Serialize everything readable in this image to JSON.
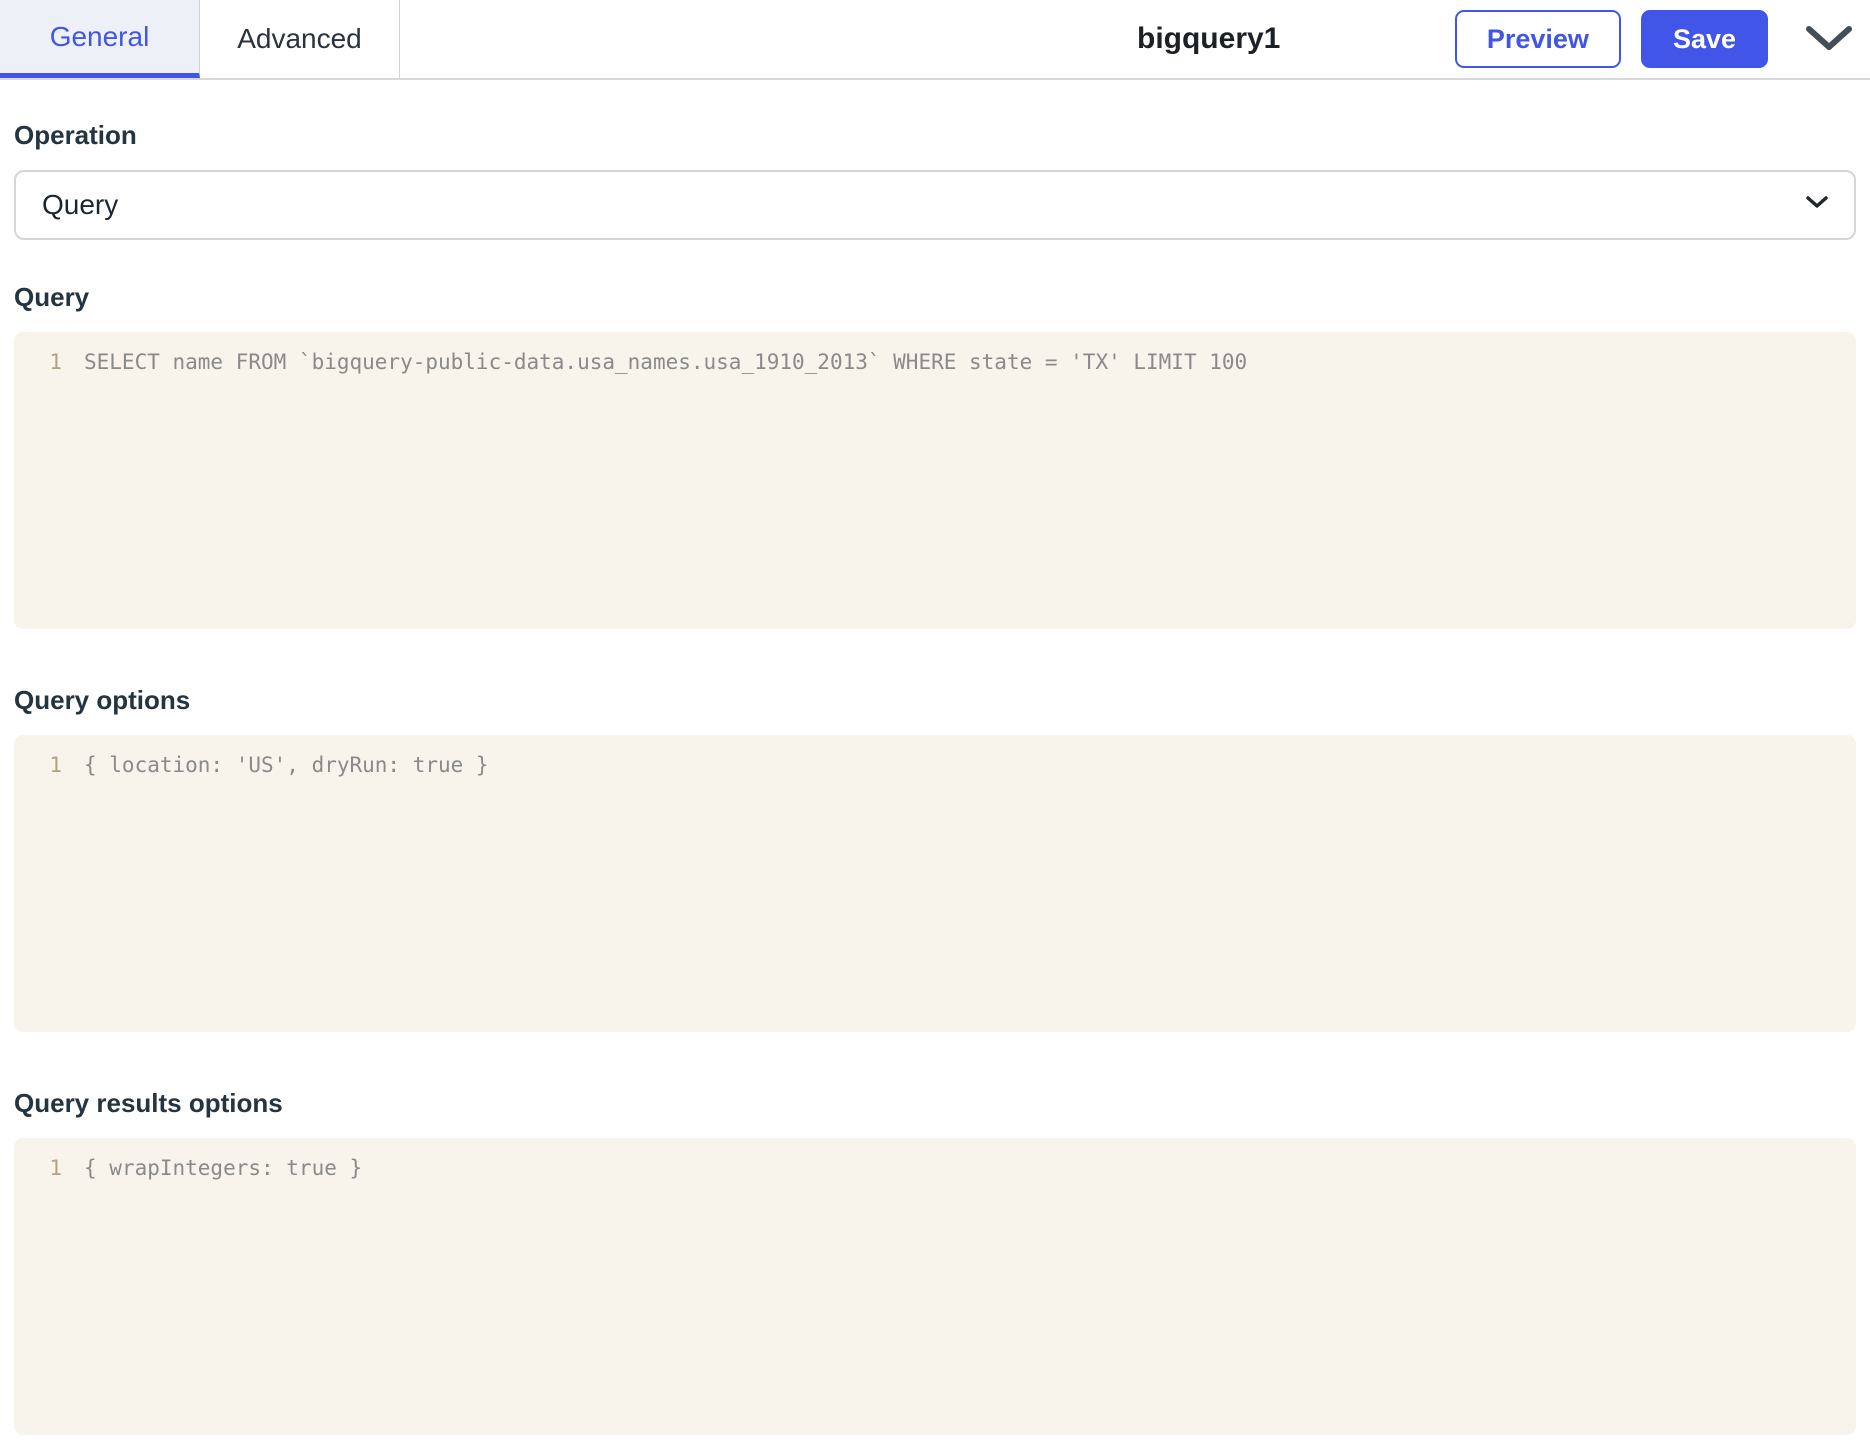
{
  "header": {
    "tabs": [
      {
        "label": "General",
        "active": true
      },
      {
        "label": "Advanced",
        "active": false
      }
    ],
    "title": "bigquery1",
    "preview_button": "Preview",
    "save_button": "Save"
  },
  "form": {
    "operation": {
      "label": "Operation",
      "value": "Query"
    },
    "sections": [
      {
        "label": "Query",
        "line_number": "1",
        "code": "SELECT name FROM `bigquery-public-data.usa_names.usa_1910_2013` WHERE state = 'TX' LIMIT 100"
      },
      {
        "label": "Query options",
        "line_number": "1",
        "code": "{ location: 'US', dryRun: true }"
      },
      {
        "label": "Query results options",
        "line_number": "1",
        "code": "{ wrapIntegers: true }"
      }
    ]
  },
  "colors": {
    "accent_blue": "#4156e8",
    "active_tab_background": "#edf0f6",
    "editor_background": "#f8f4ec",
    "code_text": "#8a8a8a",
    "line_number": "#b3a37c",
    "label_text": "#243541",
    "border_gray": "#d9d9d9"
  },
  "icons": {
    "header_more": "chevron-down-icon",
    "select_dropdown": "chevron-down-icon"
  }
}
